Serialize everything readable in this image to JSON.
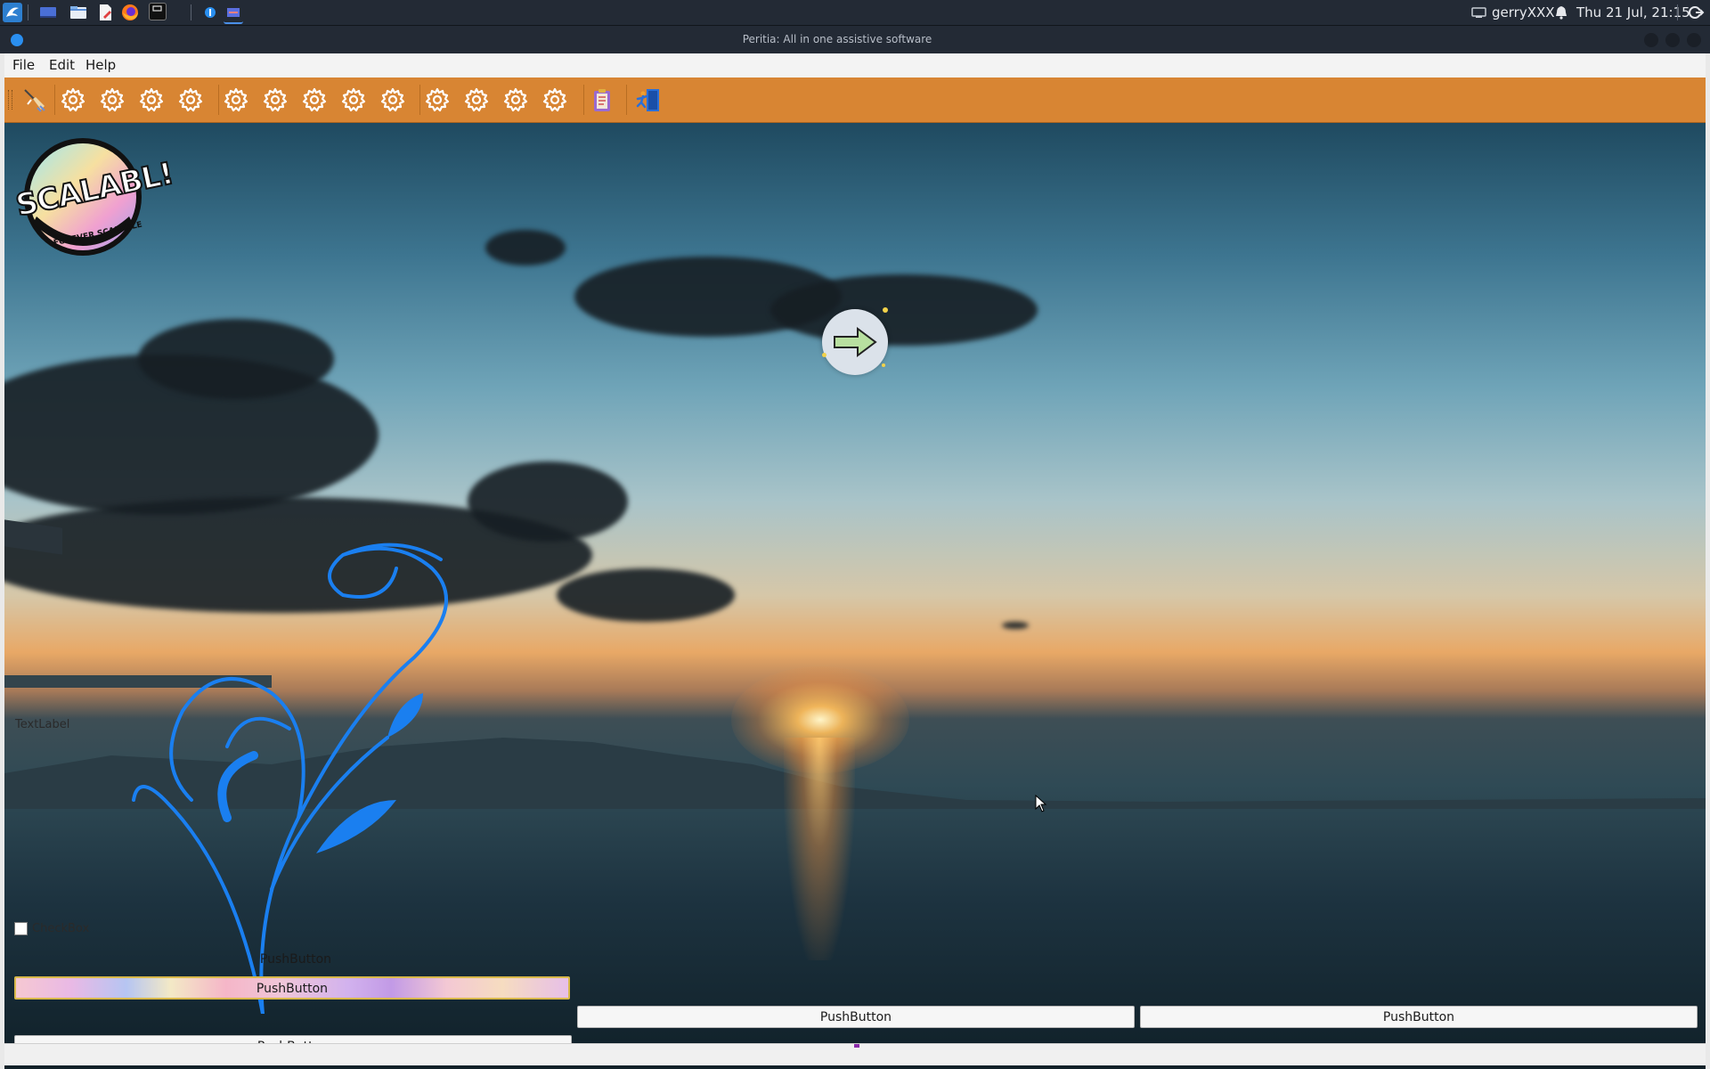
{
  "taskbar": {
    "user": "gerryXXX",
    "clock": "Thu 21 Jul, 21:15"
  },
  "window": {
    "title": "Peritia: All in one assistive software"
  },
  "menubar": {
    "items": [
      "File",
      "Edit",
      "Help"
    ]
  },
  "toolbar": {
    "icons": [
      "broom-icon",
      "gear-icon",
      "gear-icon",
      "gear-icon",
      "gear-icon",
      "gear-icon",
      "gear-icon",
      "gear-icon",
      "gear-icon",
      "gear-icon",
      "gear-icon",
      "gear-icon",
      "gear-icon",
      "gear-icon",
      "clipboard-icon",
      "exit-door-icon"
    ]
  },
  "central": {
    "logo_text": "SCALABL!",
    "logo_subtext": "FOREVER SCALABLE",
    "text_label": "TextLabel",
    "checkbox": {
      "label": "CheckBox",
      "checked": false
    },
    "buttons": {
      "flat": "PushButton",
      "rainbow": "PushButton",
      "left_bottom": "PushButton",
      "middle": "PushButton",
      "right": "PushButton"
    }
  },
  "colors": {
    "toolbar_bg": "#d88533",
    "accent_blue": "#1a7ff0",
    "titlebar_bg": "#232a35"
  }
}
